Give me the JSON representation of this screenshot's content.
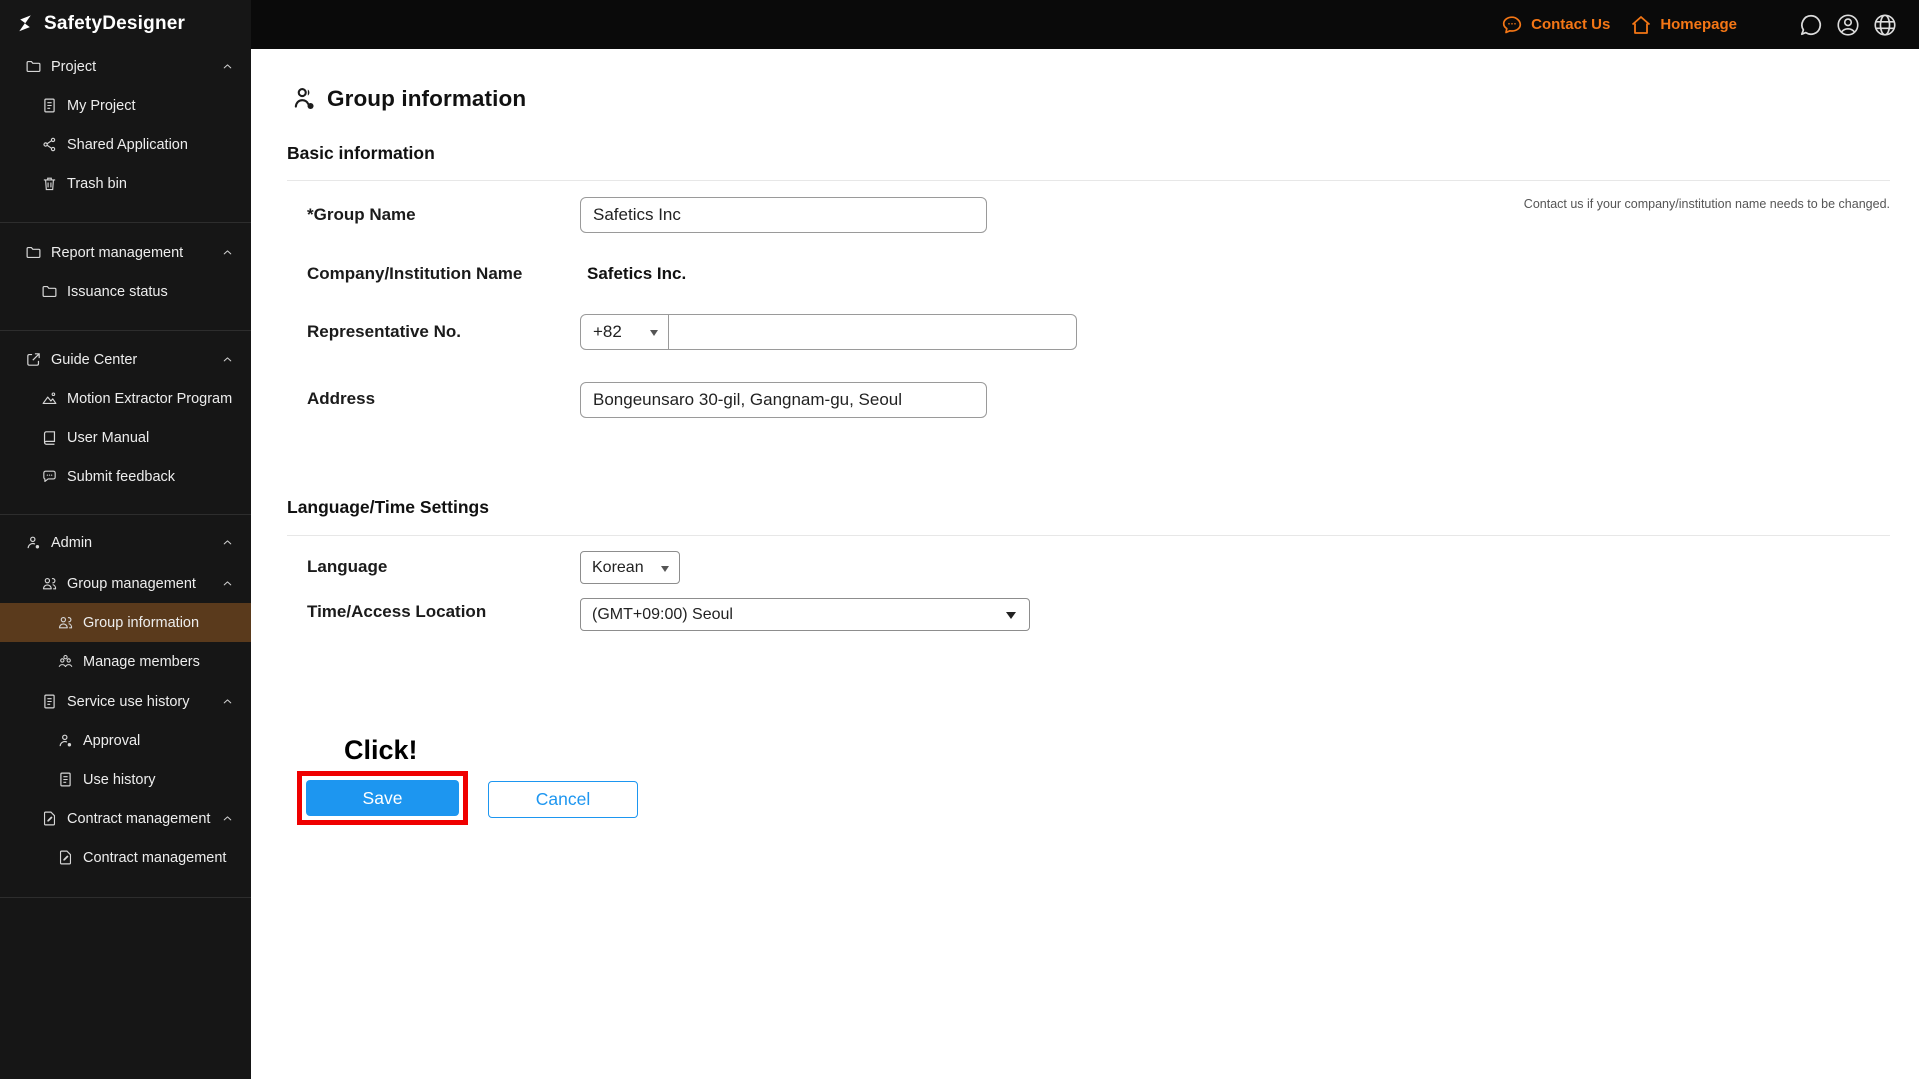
{
  "brand": {
    "name": "SafetyDesigner"
  },
  "topbar": {
    "contact_us": "Contact Us",
    "homepage": "Homepage"
  },
  "sidebar": {
    "sections": [
      {
        "items": [
          {
            "label": "Project"
          },
          {
            "label": "My Project"
          },
          {
            "label": "Shared Application"
          },
          {
            "label": "Trash bin"
          }
        ]
      },
      {
        "items": [
          {
            "label": "Report management"
          },
          {
            "label": "Issuance status"
          }
        ]
      },
      {
        "items": [
          {
            "label": "Guide Center"
          },
          {
            "label": "Motion Extractor Program"
          },
          {
            "label": "User Manual"
          },
          {
            "label": "Submit feedback"
          }
        ]
      },
      {
        "items": [
          {
            "label": "Admin"
          },
          {
            "label": "Group management"
          },
          {
            "label": "Group information",
            "selected": true
          },
          {
            "label": "Manage members"
          },
          {
            "label": "Service use history"
          },
          {
            "label": "Approval"
          },
          {
            "label": "Use history"
          },
          {
            "label": "Contract management"
          },
          {
            "label": "Contract management"
          }
        ]
      }
    ]
  },
  "main": {
    "page_title": "Group information",
    "basic": {
      "title": "Basic information",
      "note": "Contact us if your company/institution name needs to be changed.",
      "group_name_label": "*Group Name",
      "group_name_value": "Safetics Inc",
      "company_label": "Company/Institution Name",
      "company_value": "Safetics Inc.",
      "representative_label": "Representative No.",
      "country_code": "+82",
      "phone_value": "",
      "address_label": "Address",
      "address_value": "Bongeunsaro 30-gil, Gangnam-gu, Seoul"
    },
    "language": {
      "title": "Language/Time Settings",
      "language_label": "Language",
      "language_value": "Korean",
      "timezone_label": "Time/Access Location",
      "timezone_value": "(GMT+09:00) Seoul"
    },
    "actions": {
      "click_hint": "Click!",
      "save": "Save",
      "cancel": "Cancel"
    }
  },
  "colors": {
    "accent_orange": "#F47615",
    "primary_blue": "#1D96F0",
    "selected_brown": "#5A3A1C",
    "highlight_red": "#EF0000",
    "sidebar_bg": "#161616",
    "topbar_bg": "#0a0a0a"
  }
}
